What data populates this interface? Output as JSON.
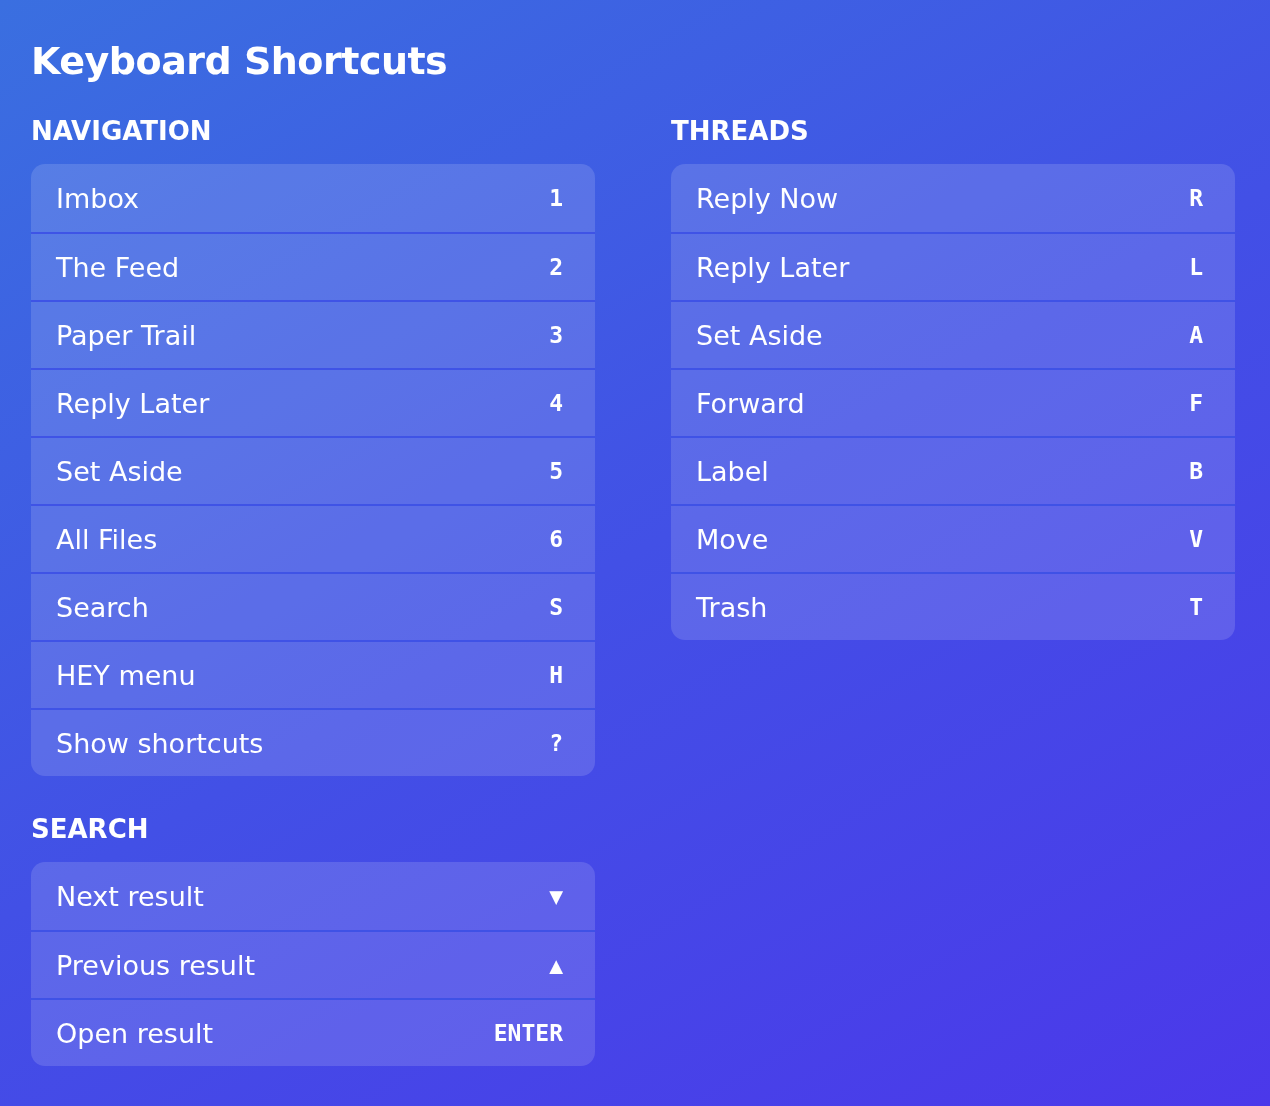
{
  "title": "Keyboard Shortcuts",
  "columns": [
    {
      "sections": [
        {
          "heading": "NAVIGATION",
          "shortcuts": [
            {
              "label": "Imbox",
              "key": "1"
            },
            {
              "label": "The Feed",
              "key": "2"
            },
            {
              "label": "Paper Trail",
              "key": "3"
            },
            {
              "label": "Reply Later",
              "key": "4"
            },
            {
              "label": "Set Aside",
              "key": "5"
            },
            {
              "label": "All Files",
              "key": "6"
            },
            {
              "label": "Search",
              "key": "S"
            },
            {
              "label": "HEY menu",
              "key": "H"
            },
            {
              "label": "Show shortcuts",
              "key": "?"
            }
          ]
        },
        {
          "heading": "SEARCH",
          "shortcuts": [
            {
              "label": "Next result",
              "key": "▼"
            },
            {
              "label": "Previous result",
              "key": "▲"
            },
            {
              "label": "Open result",
              "key": "ENTER"
            }
          ]
        }
      ]
    },
    {
      "sections": [
        {
          "heading": "THREADS",
          "shortcuts": [
            {
              "label": "Reply Now",
              "key": "R"
            },
            {
              "label": "Reply Later",
              "key": "L"
            },
            {
              "label": "Set Aside",
              "key": "A"
            },
            {
              "label": "Forward",
              "key": "F"
            },
            {
              "label": "Label",
              "key": "B"
            },
            {
              "label": "Move",
              "key": "V"
            },
            {
              "label": "Trash",
              "key": "T"
            }
          ]
        }
      ]
    }
  ]
}
